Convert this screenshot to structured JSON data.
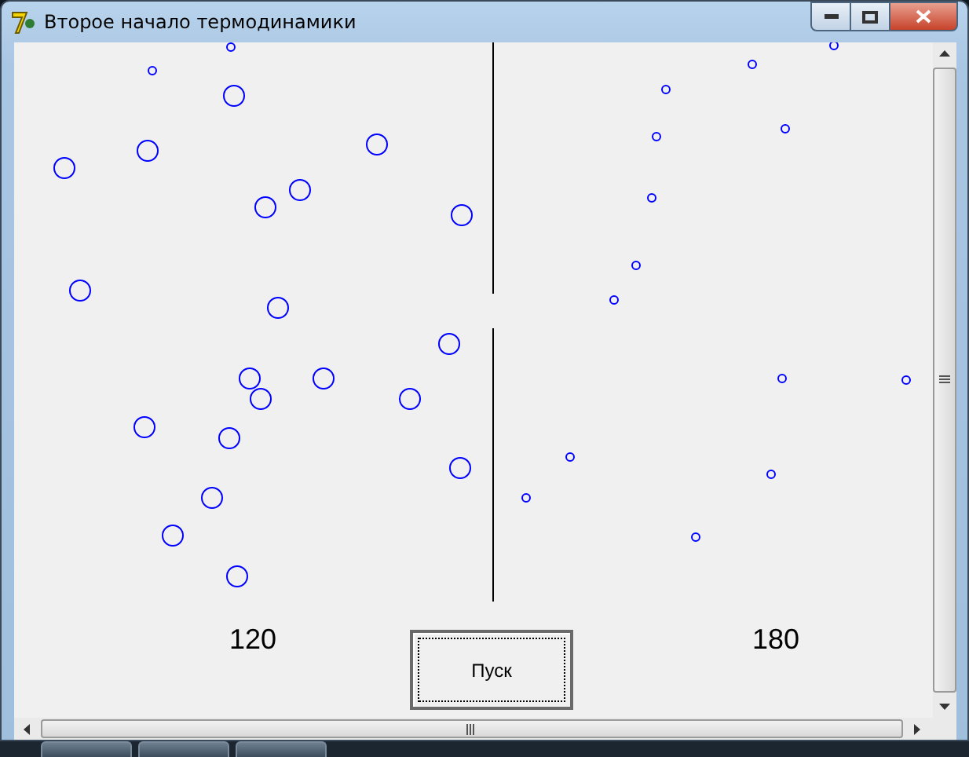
{
  "window": {
    "title": "Второе начало термодинамики"
  },
  "counters": [
    {
      "label": "120"
    },
    {
      "label": "180"
    }
  ],
  "start_button": {
    "label": "Пуск",
    "focused": true
  }
}
